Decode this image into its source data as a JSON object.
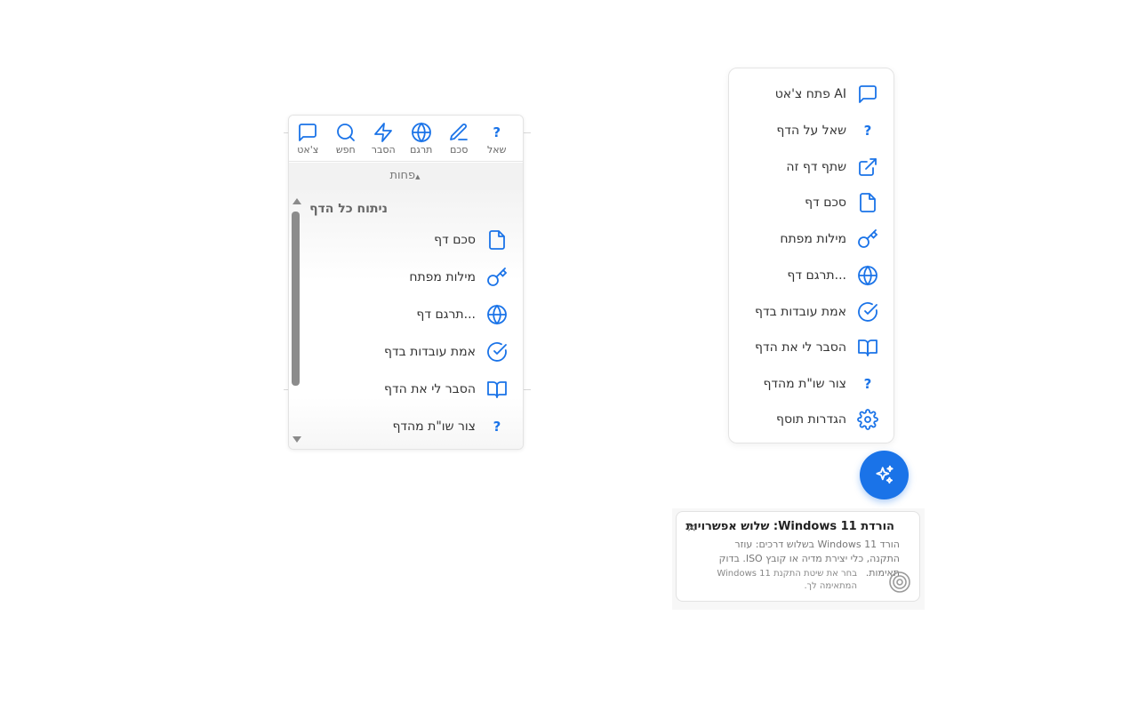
{
  "page_panel": {
    "toolbar": [
      {
        "label": "שאל",
        "icon": "question-icon"
      },
      {
        "label": "סכם",
        "icon": "pencil-icon"
      },
      {
        "label": "תרגם",
        "icon": "globe-icon"
      },
      {
        "label": "הסבר",
        "icon": "lightning-icon"
      },
      {
        "label": "חפש",
        "icon": "search-icon"
      },
      {
        "label": "צ'אט",
        "icon": "chat-icon"
      }
    ],
    "less_toggle": "פחות",
    "section_title": "ניתוח כל הדף",
    "items": [
      {
        "label": "סכם דף",
        "icon": "document-icon"
      },
      {
        "label": "מילות מפתח",
        "icon": "key-icon"
      },
      {
        "label": "תרגם דף...",
        "icon": "globe-icon"
      },
      {
        "label": "אמת עובדות בדף",
        "icon": "check-circle-icon"
      },
      {
        "label": "הסבר לי את הדף",
        "icon": "book-icon"
      },
      {
        "label": "צור שו\"ת מהדף",
        "icon": "question-icon"
      }
    ]
  },
  "floating_menu": {
    "items": [
      {
        "label": "פתח צ'אט AI",
        "icon": "chat-icon"
      },
      {
        "label": "שאל על הדף",
        "icon": "question-icon"
      },
      {
        "label": "שתף דף זה",
        "icon": "external-link-icon"
      },
      {
        "label": "סכם דף",
        "icon": "document-icon"
      },
      {
        "label": "מילות מפתח",
        "icon": "key-icon"
      },
      {
        "label": "תרגם דף...",
        "icon": "globe-icon"
      },
      {
        "label": "אמת עובדות בדף",
        "icon": "check-circle-icon"
      },
      {
        "label": "הסבר לי את הדף",
        "icon": "book-icon"
      },
      {
        "label": "צור שו\"ת מהדף",
        "icon": "question-icon"
      },
      {
        "label": "הגדרות תוסף",
        "icon": "gear-icon"
      }
    ],
    "fab_icon": "sparkles-icon"
  },
  "notification": {
    "title": "הורדת Windows 11: שלוש אפשרויות",
    "body": "הורד Windows 11 בשלוש דרכים: עוזר התקנה, כלי יצירת מדיה או קובץ ISO. בדוק תאימות.",
    "description": "בחר את שיטת התקנת Windows 11 המתאימה לך.",
    "close_label": "×"
  },
  "colors": {
    "accent": "#1a73e8",
    "text": "#333333",
    "muted": "#777777"
  }
}
